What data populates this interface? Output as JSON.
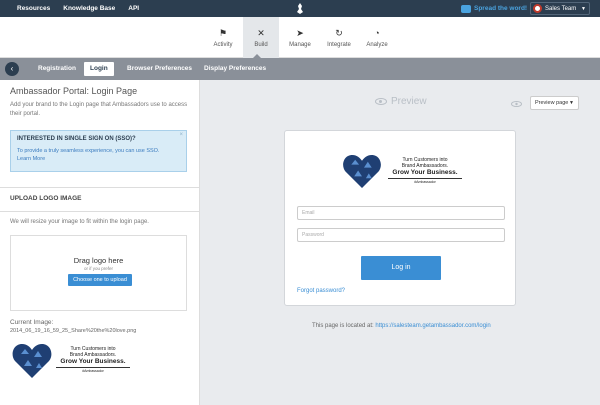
{
  "topbar": {
    "links": [
      "Resources",
      "Knowledge Base",
      "API"
    ],
    "spread_label": "Spread the word!",
    "user_label": "Sales Team"
  },
  "mainnav": [
    {
      "label": "Activity",
      "icon": "flag-icon"
    },
    {
      "label": "Build",
      "icon": "tools-icon",
      "active": true
    },
    {
      "label": "Manage",
      "icon": "paper-plane-icon"
    },
    {
      "label": "Integrate",
      "icon": "sync-icon"
    },
    {
      "label": "Analyze",
      "icon": "pie-chart-icon"
    }
  ],
  "subnav": {
    "tabs": [
      {
        "label": "Registration"
      },
      {
        "label": "Login",
        "active": true
      },
      {
        "label": "Browser Preferences"
      },
      {
        "label": "Display Preferences"
      }
    ]
  },
  "left": {
    "title": "Ambassador Portal: Login Page",
    "description": "Add your brand to the Login page that Ambassadors use to access their portal.",
    "sso": {
      "title": "INTERESTED IN SINGLE SIGN ON (SSO)?",
      "text": "To provide a truly seamless experience, you can use SSO.",
      "link": "Learn More",
      "close": "×"
    },
    "upload": {
      "heading": "UPLOAD LOGO IMAGE",
      "description": "We will resize your image to fit within the login page.",
      "drop_main": "Drag logo here",
      "drop_sub": "or if you prefer",
      "button": "Choose one to upload",
      "current_label": "Current Image:",
      "current_file": "2014_06_19_16_59_25_Share%20the%20love.png"
    }
  },
  "logo_text": {
    "line1": "Turn Customers into",
    "line2": "Brand Ambassadors.",
    "line3": "Grow Your Business.",
    "tag": "#Ambassador"
  },
  "preview": {
    "label": "Preview",
    "button": "Preview page",
    "email_placeholder": "Email",
    "password_placeholder": "Password",
    "login_button": "Log in",
    "forgot": "Forgot password?",
    "located_prefix": "This page is located at:",
    "located_url": "https://salesteam.getambassador.com/login"
  },
  "colors": {
    "topbar": "#2c3e50",
    "accent": "#3a8ed4",
    "subnav": "#8a9099",
    "sso_bg": "#d9ecf7"
  }
}
